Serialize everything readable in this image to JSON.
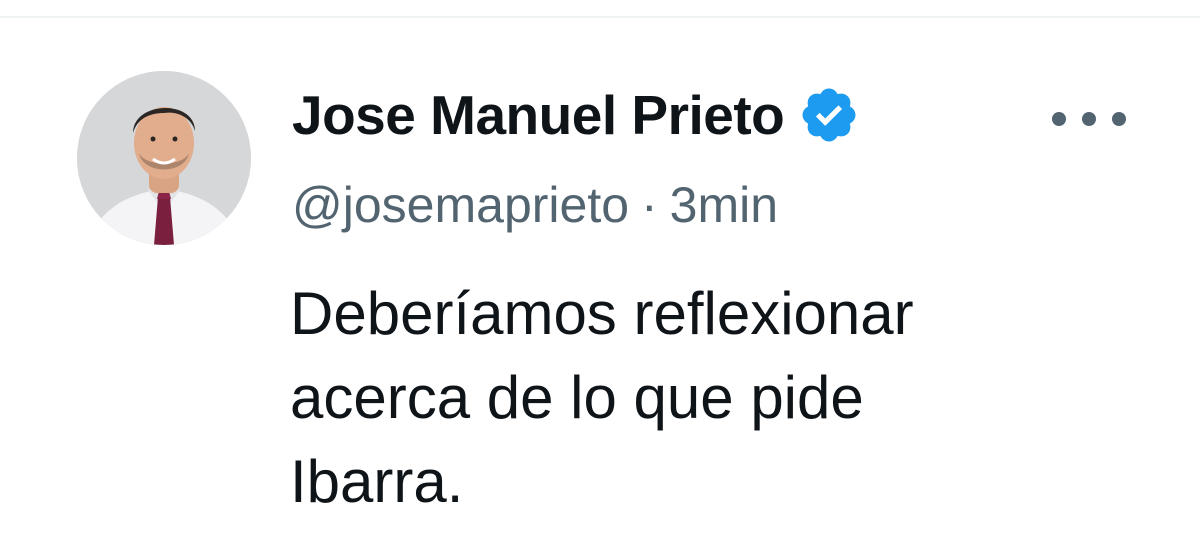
{
  "tweet": {
    "author": {
      "display_name": "Jose Manuel Prieto",
      "handle": "@josemaprieto",
      "verified": true,
      "verified_icon": "verified-badge-icon",
      "avatar": "profile-photo"
    },
    "meta": {
      "separator": "·",
      "timestamp": "3min"
    },
    "text_lines": [
      "Deberíamos reflexionar",
      "acerca de lo que pide",
      "Ibarra."
    ],
    "more_icon": "more-options-icon"
  },
  "colors": {
    "text_primary": "#0f1419",
    "text_secondary": "#536471",
    "verified_blue": "#1d9bf0",
    "divider": "#eff3f4"
  }
}
